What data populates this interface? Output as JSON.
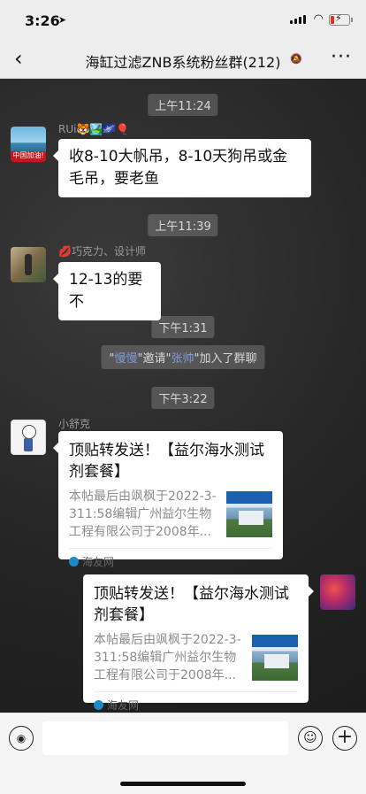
{
  "status": {
    "time": "3:26",
    "location_glyph": "➤",
    "wifi_glyph": "◠",
    "bolt": "⚡"
  },
  "nav": {
    "back": "‹",
    "title": "海缸过滤ZNB系统粉丝群(212)",
    "mute": "🔕",
    "more": "···"
  },
  "messages": {
    "t1": "上午11:24",
    "m1": {
      "sender": "RUi🐯🏞️🌌🎈",
      "avatar_text": "中国加油!",
      "text": "收8-10大帆吊，8-10天狗吊或金毛吊，要老鱼"
    },
    "t2": "上午11:39",
    "m2": {
      "sender": "💋巧克力、设计师",
      "text": "12-13的要不"
    },
    "t3": "下午1:31",
    "sys": {
      "q1": "\"",
      "name1": "慢慢",
      "mid": "\"邀请\"",
      "name2": "张帅",
      "end": "\"加入了群聊"
    },
    "t4": "下午3:22",
    "m3": {
      "sender": "小舒克",
      "title": "顶贴转发送！【益尔海水测试剂套餐】",
      "desc": "本帖最后由飒枫于2022-3-311:58编辑广州益尔生物工程有限公司于2008年...",
      "source": "海友网"
    },
    "m4": {
      "title": "顶贴转发送！【益尔海水测试剂套餐】",
      "desc": "本帖最后由飒枫于2022-3-311:58编辑广州益尔生物工程有限公司于2008年...",
      "source": "海友网"
    }
  },
  "bottom": {
    "voice_glyph": "◉",
    "emoji_glyph": "☺",
    "plus_glyph": "+"
  }
}
